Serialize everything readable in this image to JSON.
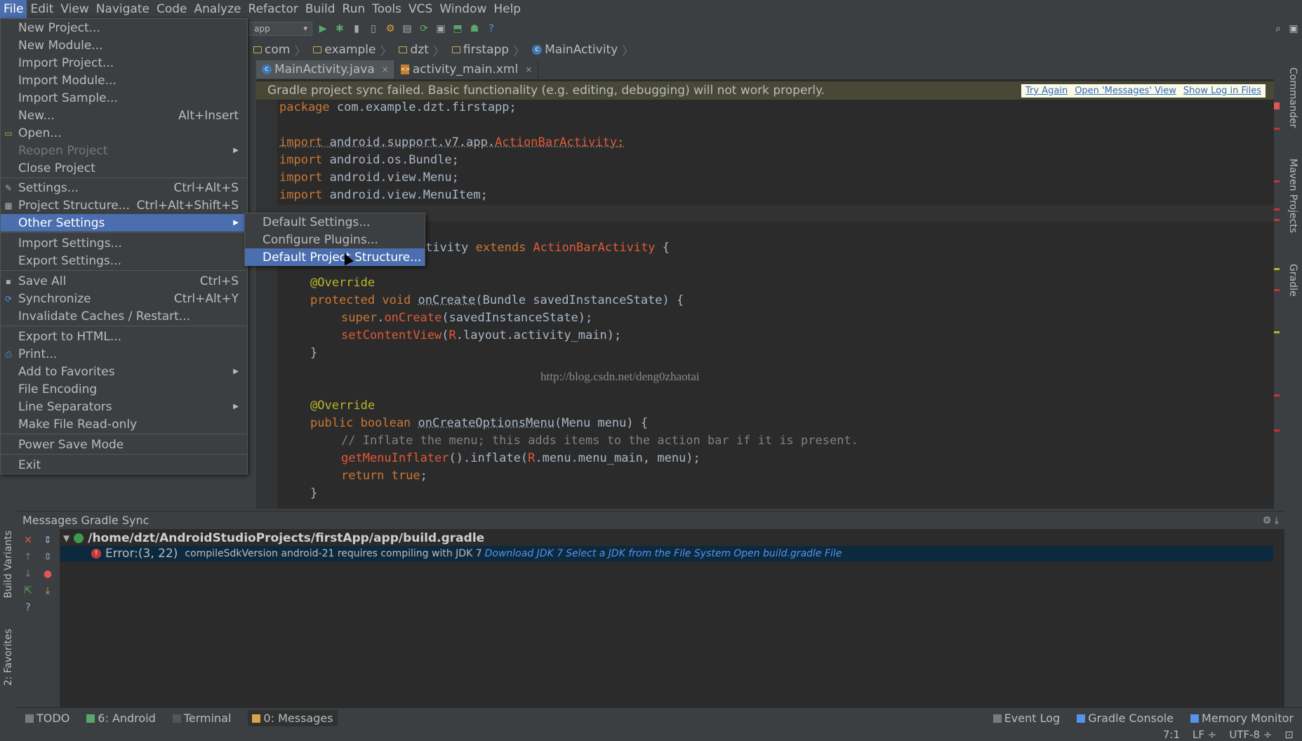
{
  "menubar": [
    "File",
    "Edit",
    "View",
    "Navigate",
    "Code",
    "Analyze",
    "Refactor",
    "Build",
    "Run",
    "Tools",
    "VCS",
    "Window",
    "Help"
  ],
  "toolbar": {
    "run_config": "app",
    "help": "?"
  },
  "breadcrumb": [
    "com",
    "example",
    "dzt",
    "firstapp",
    "MainActivity"
  ],
  "tabs": [
    {
      "label": "MainActivity.java",
      "close": "×"
    },
    {
      "label": "activity_main.xml",
      "close": "×"
    }
  ],
  "banner": {
    "message": "Gradle project sync failed. Basic functionality (e.g. editing, debugging) will not work properly.",
    "try_again": "Try Again",
    "open_messages": "Open 'Messages' View",
    "show_log": "Show Log in Files"
  },
  "code": {
    "l1a": "package ",
    "l1b": "com.example.dzt.firstapp;",
    "l3a": "import ",
    "l3b": "android.support.v7.app.",
    "l3c": "ActionBarActivity",
    "l3d": ";",
    "l4a": "import ",
    "l4b": "android.os.Bundle;",
    "l5a": "import ",
    "l5b": "android.view.Menu;",
    "l6a": "import ",
    "l6b": "android.view.MenuItem;",
    "l8a": "tivity ",
    "l8b": "extends ",
    "l8c": "ActionBarActivity",
    "l8d": " {",
    "l10": "@Override",
    "l11a": "protected void ",
    "l11b": "onCreate",
    "l11c": "(Bundle savedInstanceState) {",
    "l12a": "super",
    "l12b": ".",
    "l12c": "onCreate",
    "l12d": "(savedInstanceState);",
    "l13a": "setContentView",
    "l13b": "(",
    "l13c": "R",
    "l13d": ".layout.activity_main);",
    "l14": "}",
    "l16": "@Override",
    "l17a": "public boolean ",
    "l17b": "onCreateOptionsMenu",
    "l17c": "(Menu menu) {",
    "l18": "// Inflate the menu; this adds items to the action bar if it is present.",
    "l19a": "getMenuInflater",
    "l19b": "().inflate(",
    "l19c": "R",
    "l19d": ".menu.menu_main, menu);",
    "l20a": "return true",
    "l20b": ";",
    "l21": "}"
  },
  "watermark": "http://blog.csdn.net/deng0zhaotai",
  "file_menu": {
    "new_project": "New Project...",
    "new_module": "New Module...",
    "import_project": "Import Project...",
    "import_module": "Import Module...",
    "import_sample": "Import Sample...",
    "new": "New...",
    "new_shortcut": "Alt+Insert",
    "open": "Open...",
    "reopen_project": "Reopen Project",
    "close_project": "Close Project",
    "settings": "Settings...",
    "settings_shortcut": "Ctrl+Alt+S",
    "project_structure": "Project Structure...",
    "project_structure_shortcut": "Ctrl+Alt+Shift+S",
    "other_settings": "Other Settings",
    "import_settings": "Import Settings...",
    "export_settings": "Export Settings...",
    "save_all": "Save All",
    "save_all_shortcut": "Ctrl+S",
    "synchronize": "Synchronize",
    "synchronize_shortcut": "Ctrl+Alt+Y",
    "invalidate_caches": "Invalidate Caches / Restart...",
    "export_html": "Export to HTML...",
    "print": "Print...",
    "add_favorites": "Add to Favorites",
    "file_encoding": "File Encoding",
    "line_separators": "Line Separators",
    "make_read_only": "Make File Read-only",
    "power_save": "Power Save Mode",
    "exit": "Exit"
  },
  "sub_menu": {
    "default_settings": "Default Settings...",
    "configure_plugins": "Configure Plugins...",
    "default_project_structure": "Default Project Structure..."
  },
  "right_strip": {
    "commander": "Commander",
    "maven": "Maven Projects",
    "gradle": "Gradle"
  },
  "left_strip": {
    "build_variants": "Build Variants",
    "favorites": "2: Favorites"
  },
  "messages": {
    "title": "Messages Gradle Sync",
    "path": "/home/dzt/AndroidStudioProjects/firstApp/app/build.gradle",
    "error_loc": "Error:(3, 22)",
    "error_text": "compileSdkVersion android-21 requires compiling with JDK 7",
    "link1": "Download JDK 7",
    "link2": "Select a JDK from the File System",
    "link3": "Open build.gradle File"
  },
  "bottom_tabs": {
    "todo": "TODO",
    "android": "6: Android",
    "terminal": "Terminal",
    "messages": "0: Messages",
    "event_log": "Event Log",
    "gradle_console": "Gradle Console",
    "memory_monitor": "Memory Monitor"
  },
  "status": {
    "position": "7:1",
    "line_sep": "LF ÷",
    "encoding": "UTF-8 ÷"
  }
}
